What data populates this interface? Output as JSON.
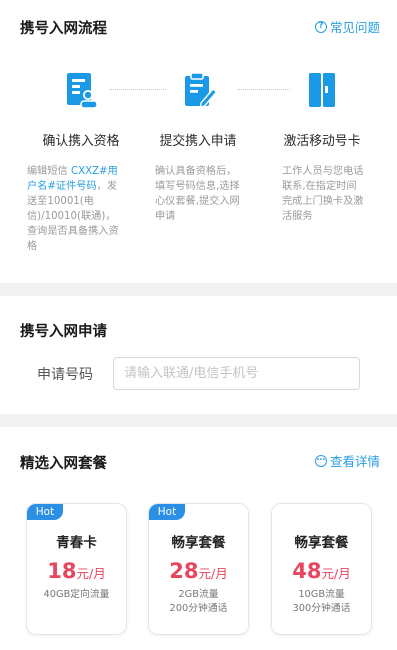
{
  "process": {
    "title": "携号入网流程",
    "help_icon": "?",
    "help_label": "常见问题",
    "steps": [
      {
        "icon": "id-card-icon",
        "title": "确认携入资格",
        "desc_parts": [
          "编辑短信 ",
          "CXXZ#用户名#证件号码",
          "，发送至10001(电信)/10010(联通)，查询是否具备携入资格"
        ]
      },
      {
        "icon": "clipboard-edit-icon",
        "title": "提交携入申请",
        "desc": "确认具备资格后，填写号码信息,选择心仪套餐,提交入网申请"
      },
      {
        "icon": "sim-card-icon",
        "title": "激活移动号卡",
        "desc": "工作人员与您电话联系,在指定时间完成上门换卡及激活服务"
      }
    ]
  },
  "apply": {
    "title": "携号入网申请",
    "field_label": "申请号码",
    "placeholder": "请输入联通/电信手机号"
  },
  "packages": {
    "title": "精选入网套餐",
    "detail_icon": "⋯",
    "detail_label": "查看详情",
    "items": [
      {
        "badge": "Hot",
        "name": "青春卡",
        "price": "18",
        "unit": "元/月",
        "features": [
          "40GB定向流量"
        ]
      },
      {
        "badge": "Hot",
        "name": "畅享套餐",
        "price": "28",
        "unit": "元/月",
        "features": [
          "2GB流量",
          "200分钟通话"
        ]
      },
      {
        "badge": "",
        "name": "畅享套餐",
        "price": "48",
        "unit": "元/月",
        "features": [
          "10GB流量",
          "300分钟通话"
        ]
      }
    ]
  },
  "colors": {
    "accent_blue": "#2a9fe0",
    "icon_blue": "#1a9ae6",
    "price_red": "#e8455f",
    "divider_gray": "#f2f2f2"
  }
}
